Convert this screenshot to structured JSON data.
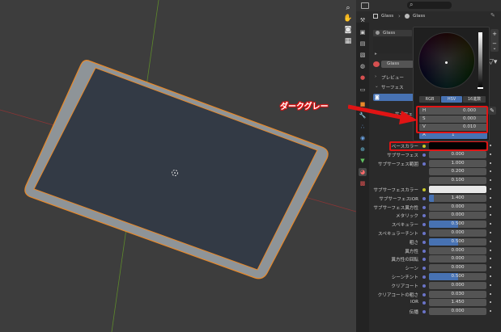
{
  "properties_header": {
    "breadcrumb_object": "Glass",
    "breadcrumb_material": "Glass",
    "slot_name": "Glass",
    "material_name": "Glass"
  },
  "sections": {
    "preview": "プレビュー",
    "surface": "サーフェス",
    "surface_label_cut": "サーフェ"
  },
  "color_picker": {
    "tabs": [
      "RGB",
      "HSV",
      "16進数"
    ],
    "active_tab": "HSV",
    "hsv": [
      {
        "label": "H",
        "value": "0.000"
      },
      {
        "label": "S",
        "value": "0.000"
      },
      {
        "label": "V",
        "value": "0.010"
      }
    ],
    "alpha": {
      "label": "A",
      "value": "1"
    }
  },
  "annotation": {
    "text": "ダークグレー",
    "color": "#e01414"
  },
  "rows": [
    {
      "label": "ベースカラー",
      "value": "",
      "type": "color",
      "color": "#020202"
    },
    {
      "label": "サブサーフェス",
      "value": "0.000",
      "fill": 0
    },
    {
      "label": "サブサーフェス範囲",
      "value": "1.000",
      "fill": 0
    },
    {
      "label": "",
      "value": "0.200",
      "fill": 0
    },
    {
      "label": "",
      "value": "0.100",
      "fill": 0
    },
    {
      "label": "サブサーフェスカラー",
      "value": "",
      "type": "color",
      "color": "#e8e8e8"
    },
    {
      "label": "サブサーフェスIOR",
      "value": "1.400",
      "fill": 0.08
    },
    {
      "label": "サブサーフェス異方性",
      "value": "0.000",
      "fill": 0
    },
    {
      "label": "メタリック",
      "value": "0.000",
      "fill": 0
    },
    {
      "label": "スペキュラー",
      "value": "0.500",
      "fill": 0.5
    },
    {
      "label": "スペキュラーチント",
      "value": "0.000",
      "fill": 0
    },
    {
      "label": "粗さ",
      "value": "0.500",
      "fill": 0.5
    },
    {
      "label": "異方性",
      "value": "0.000",
      "fill": 0
    },
    {
      "label": "異方性の回転",
      "value": "0.000",
      "fill": 0
    },
    {
      "label": "シーン",
      "value": "0.000",
      "fill": 0
    },
    {
      "label": "シーンチント",
      "value": "0.500",
      "fill": 0.5
    },
    {
      "label": "クリアコート",
      "value": "0.000",
      "fill": 0
    },
    {
      "label": "クリアコートの粗さ",
      "value": "0.030",
      "fill": 0
    },
    {
      "label": "IOR",
      "value": "1.450",
      "fill": 0
    },
    {
      "label": "伝播",
      "value": "0.000",
      "fill": 0
    }
  ],
  "colors": {
    "accent": "#4772b3",
    "selection_outline": "#e8892a",
    "annotation_red": "#e01414"
  },
  "icons": [
    "magnifier-icon",
    "hand-icon",
    "camera-icon",
    "grid-icon",
    "pin-icon"
  ]
}
